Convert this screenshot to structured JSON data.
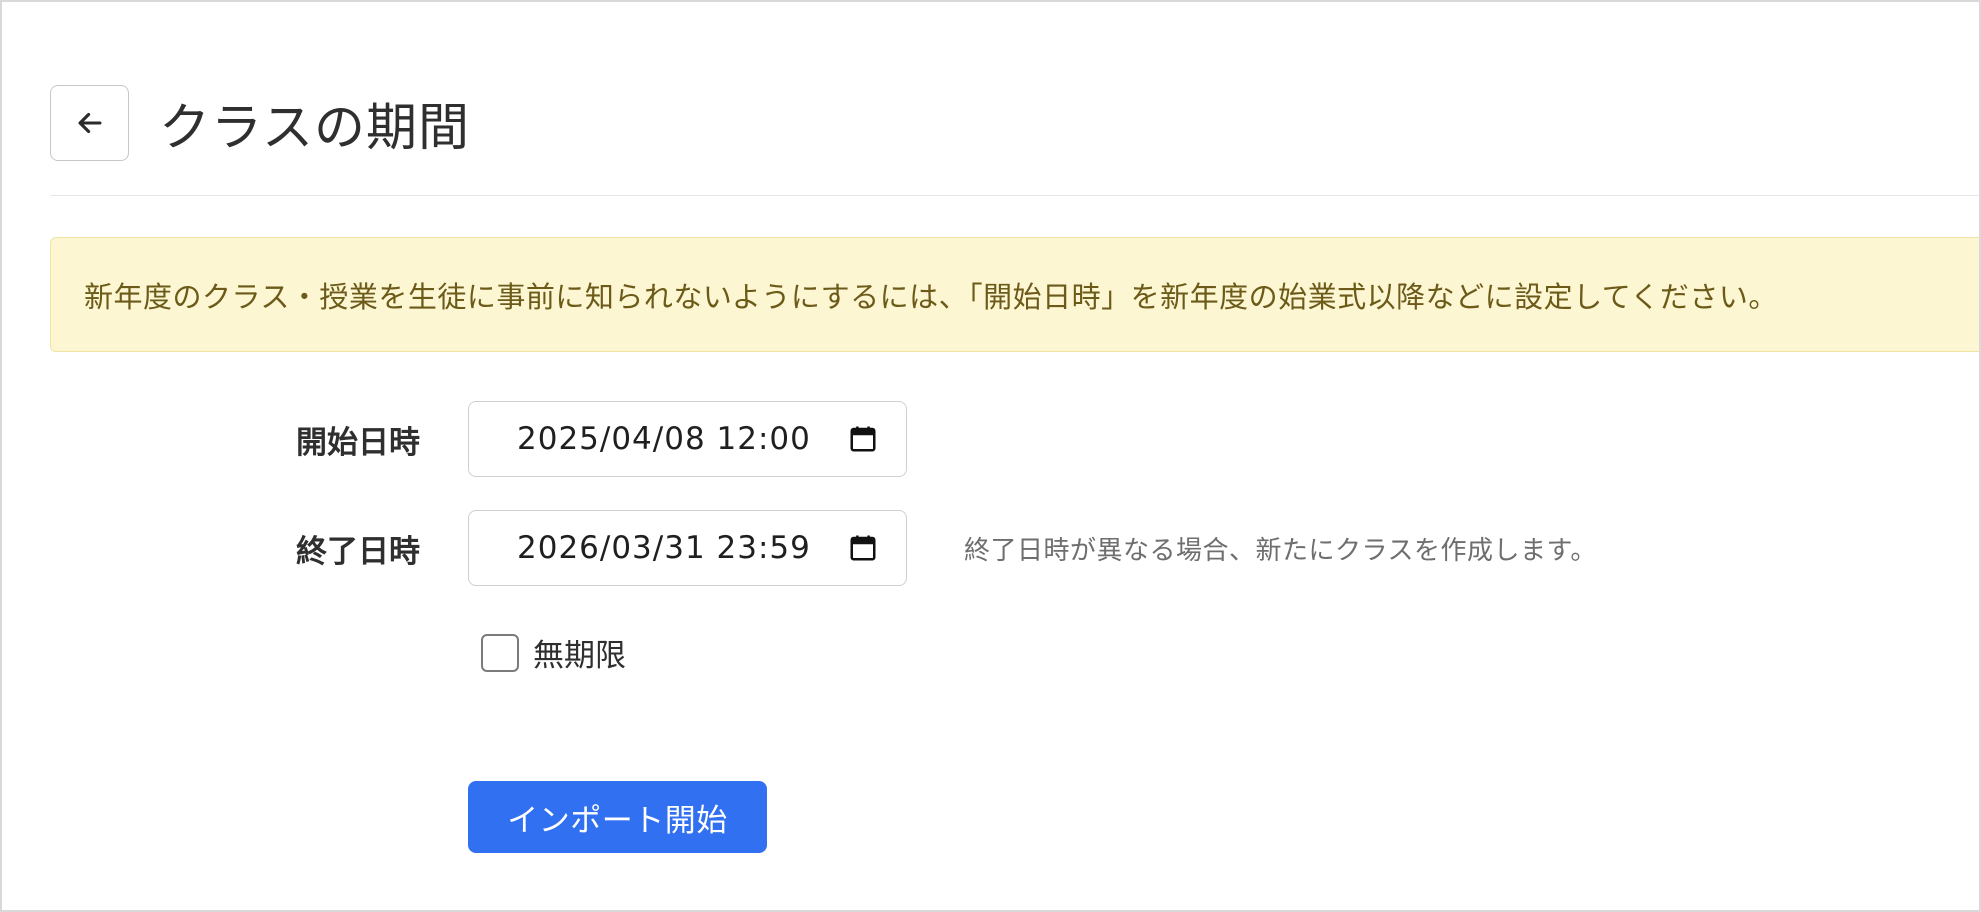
{
  "header": {
    "title": "クラスの期間",
    "back_icon": "arrow-left-icon"
  },
  "notice": {
    "text": "新年度のクラス・授業を生徒に事前に知られないようにするには、「開始日時」を新年度の始業式以降などに設定してください。"
  },
  "form": {
    "start": {
      "label": "開始日時",
      "value": "2025/04/08 12:00",
      "icon": "calendar-icon"
    },
    "end": {
      "label": "終了日時",
      "value": "2026/03/31 23:59",
      "icon": "calendar-icon",
      "help": "終了日時が異なる場合、新たにクラスを作成します。"
    },
    "no_limit": {
      "label": "無期限",
      "checked": false
    },
    "submit_label": "インポート開始"
  },
  "colors": {
    "primary": "#3170f0",
    "notice_bg": "#fdf6d3",
    "notice_text": "#6b5a18"
  }
}
